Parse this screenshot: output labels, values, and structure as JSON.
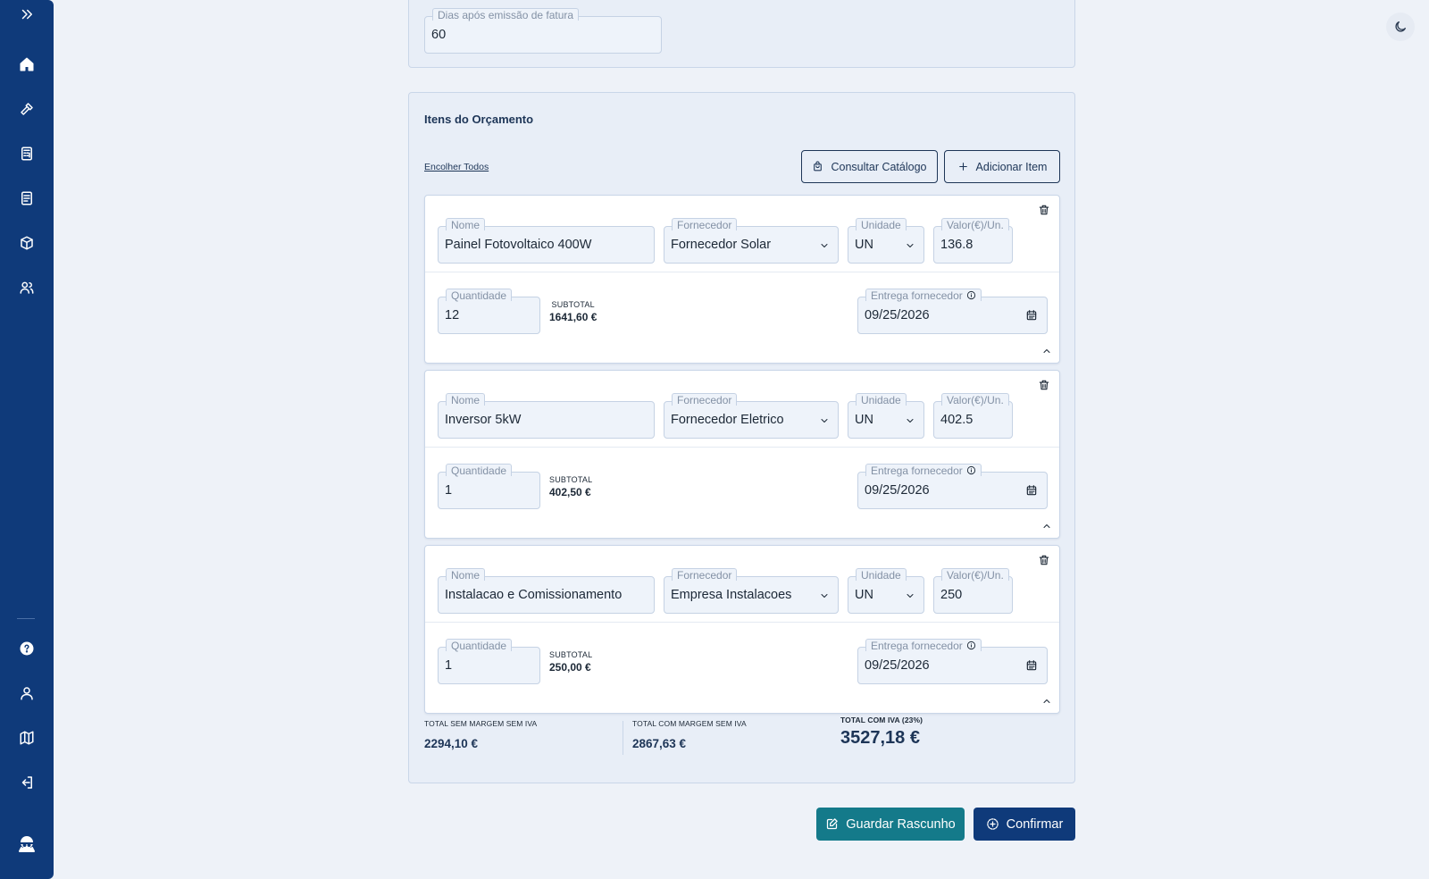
{
  "theme_toggle": {
    "icon": "moon-icon"
  },
  "sidebar": {
    "expand_icon": "chevrons-right-icon",
    "items": [
      {
        "name": "home",
        "icon": "home-icon"
      },
      {
        "name": "tools",
        "icon": "hammer-icon"
      },
      {
        "name": "calculator",
        "icon": "calculator-icon"
      },
      {
        "name": "documents",
        "icon": "document-icon"
      },
      {
        "name": "products",
        "icon": "package-icon"
      },
      {
        "name": "clients",
        "icon": "users-icon"
      }
    ],
    "bottom_items": [
      {
        "name": "help",
        "icon": "help-icon"
      },
      {
        "name": "profile",
        "icon": "user-icon"
      },
      {
        "name": "map",
        "icon": "map-icon"
      },
      {
        "name": "logout",
        "icon": "logout-icon"
      },
      {
        "name": "logo",
        "icon": "logo-icon"
      }
    ]
  },
  "payment_terms": {
    "label": "Dias após emissão de fatura",
    "value": "60"
  },
  "items_section": {
    "title": "Itens do Orçamento",
    "collapse_all": "Encolher Todos",
    "catalog_button": "Consultar Catálogo",
    "add_button": "Adicionar Item",
    "labels": {
      "name": "Nome",
      "supplier": "Fornecedor",
      "unit": "Unidade",
      "price": "Valor(€)/Un.",
      "quantity": "Quantidade",
      "subtotal": "SUBTOTAL",
      "delivery": "Entrega fornecedor"
    },
    "items": [
      {
        "name": "Painel Fotovoltaico 400W",
        "supplier": "Fornecedor Solar",
        "unit": "UN",
        "price": "136.8",
        "quantity": "12",
        "subtotal": "1641,60 €",
        "delivery": "09/25/2026"
      },
      {
        "name": "Inversor 5kW",
        "supplier": "Fornecedor Eletrico",
        "unit": "UN",
        "price": "402.5",
        "quantity": "1",
        "subtotal": "402,50 €",
        "delivery": "09/25/2026"
      },
      {
        "name": "Instalacao e Comissionamento",
        "supplier": "Empresa Instalacoes",
        "unit": "UN",
        "price": "250",
        "quantity": "1",
        "subtotal": "250,00 €",
        "delivery": "09/25/2026"
      }
    ]
  },
  "totals": {
    "no_margin_no_vat_label": "TOTAL SEM MARGEM SEM IVA",
    "no_margin_no_vat_value": "2294,10 €",
    "margin_no_vat_label": "TOTAL COM MARGEM SEM IVA",
    "margin_no_vat_value": "2867,63 €",
    "with_vat_label": "TOTAL COM IVA (23%)",
    "with_vat_value": "3527,18 €"
  },
  "actions": {
    "draft_button": "Guardar Rascunho",
    "confirm_button": "Confirmar"
  },
  "colors": {
    "sidebar": "#0f3a7a",
    "draft": "#147a8a",
    "confirm": "#0f3a7a"
  }
}
